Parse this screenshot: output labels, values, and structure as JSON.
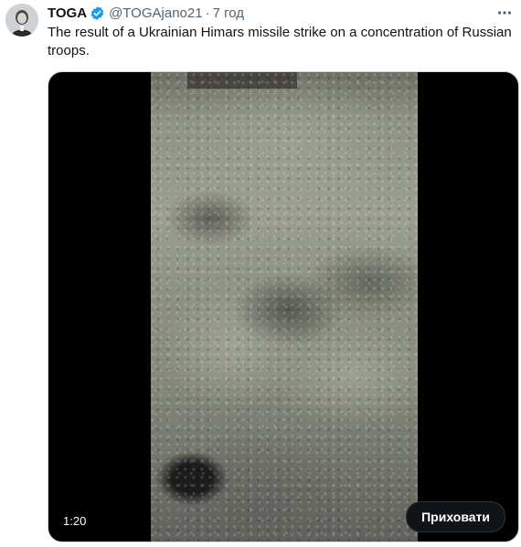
{
  "tweet": {
    "author_name": "TOGA",
    "author_handle": "@TOGAjano21",
    "separator": "·",
    "time": "7 год",
    "text": "The result of a Ukrainian Himars missile strike on a concentration of Russian troops."
  },
  "media": {
    "duration": "1:20",
    "hide_label": "Приховати"
  },
  "icons": {
    "verified": "verified-badge-icon",
    "more": "more-options-icon",
    "avatar": "avatar-image"
  },
  "colors": {
    "verified": "#1d9bf0",
    "secondary_text": "#536471",
    "primary_text": "#0f1419",
    "media_bg": "#000000"
  }
}
